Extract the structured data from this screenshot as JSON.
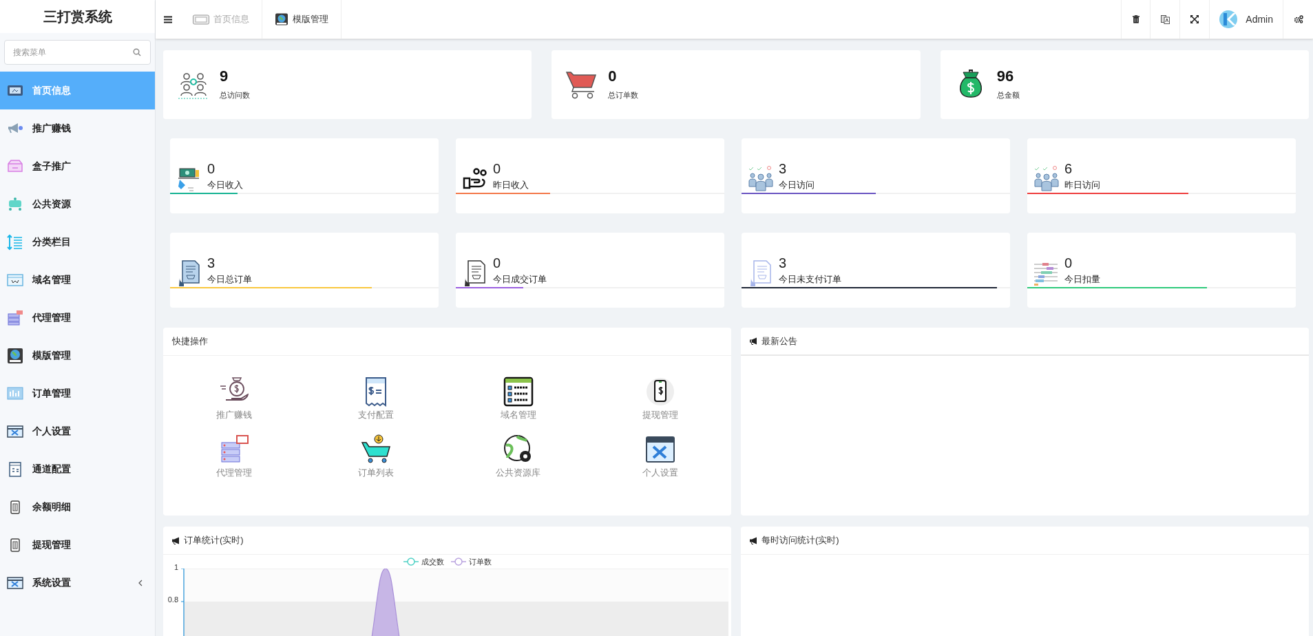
{
  "app": {
    "title": "三打赏系统"
  },
  "sidebar": {
    "search": {
      "placeholder": "搜索菜单"
    },
    "items": [
      {
        "label": "首页信息",
        "selected": true,
        "submenu": false
      },
      {
        "label": "推广赚钱",
        "selected": false,
        "submenu": false
      },
      {
        "label": "盒子推广",
        "selected": false,
        "submenu": false
      },
      {
        "label": "公共资源",
        "selected": false,
        "submenu": false
      },
      {
        "label": "分类栏目",
        "selected": false,
        "submenu": false
      },
      {
        "label": "域名管理",
        "selected": false,
        "submenu": false
      },
      {
        "label": "代理管理",
        "selected": false,
        "submenu": false
      },
      {
        "label": "模版管理",
        "selected": false,
        "submenu": false
      },
      {
        "label": "订单管理",
        "selected": false,
        "submenu": false
      },
      {
        "label": "个人设置",
        "selected": false,
        "submenu": false
      },
      {
        "label": "通道配置",
        "selected": false,
        "submenu": false
      },
      {
        "label": "余额明细",
        "selected": false,
        "submenu": false
      },
      {
        "label": "提现管理",
        "selected": false,
        "submenu": false
      },
      {
        "label": "系统设置",
        "selected": false,
        "submenu": true
      }
    ]
  },
  "topbar": {
    "tabs": [
      {
        "label": "首页信息",
        "selected": false
      },
      {
        "label": "模版管理",
        "selected": true
      }
    ],
    "user": "Admin"
  },
  "summary": [
    {
      "value": "9",
      "label": "总访问数"
    },
    {
      "value": "0",
      "label": "总订单数"
    },
    {
      "value": "96",
      "label": "总金额"
    }
  ],
  "stats": [
    {
      "value": "0",
      "label": "今日收入",
      "level": 0.25,
      "color": "#16b393"
    },
    {
      "value": "0",
      "label": "昨日收入",
      "level": 0.35,
      "color": "#f4784a"
    },
    {
      "value": "3",
      "label": "今日访问",
      "level": 0.5,
      "color": "#6a55c2"
    },
    {
      "value": "6",
      "label": "昨日访问",
      "level": 0.6,
      "color": "#ee3f3f"
    },
    {
      "value": "3",
      "label": "今日总订单",
      "level": 0.75,
      "color": "#f9c73d"
    },
    {
      "value": "0",
      "label": "今日成交订单",
      "level": 0.25,
      "color": "#9b5fe0"
    },
    {
      "value": "3",
      "label": "今日未支付订单",
      "level": 0.95,
      "color": "#1e2535"
    },
    {
      "value": "0",
      "label": "今日扣量",
      "level": 0.67,
      "color": "#2ec97b"
    }
  ],
  "quick_actions": {
    "title": "快捷操作",
    "items": [
      "推广赚钱",
      "支付配置",
      "域名管理",
      "提现管理",
      "代理管理",
      "订单列表",
      "公共资源库",
      "个人设置"
    ]
  },
  "notices": {
    "title": "最新公告"
  },
  "order_chart": {
    "title": "订单统计(实时)",
    "legend": [
      {
        "name": "成交数",
        "color": "#4fd1c5"
      },
      {
        "name": "订单数",
        "color": "#b9a3df"
      }
    ],
    "yticks": [
      "1",
      "0.8"
    ]
  },
  "visit_chart": {
    "title": "每时访问统计(实时)"
  }
}
